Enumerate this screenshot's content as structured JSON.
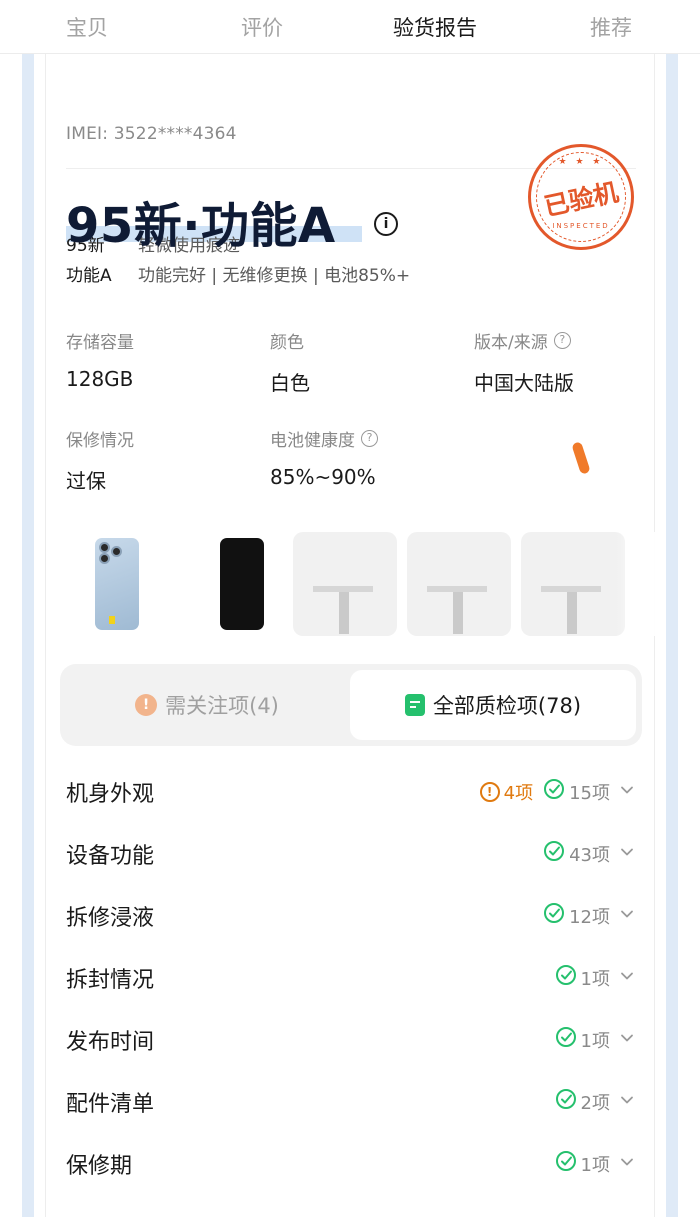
{
  "nav": {
    "tabs": [
      "宝贝",
      "评价",
      "验货报告",
      "推荐"
    ],
    "active_index": 2
  },
  "device": {
    "imei": "IMEI: 3522****4364",
    "grade_title": "95新·功能A",
    "stamp_text": "已验机",
    "stamp_sub": "INSPECTED",
    "grades": [
      {
        "key": "95新",
        "desc": "轻微使用痕迹"
      },
      {
        "key": "功能A",
        "desc": "功能完好 | 无维修更换 | 电池85%+"
      }
    ],
    "specs": [
      {
        "label": "存储容量",
        "value": "128GB"
      },
      {
        "label": "颜色",
        "value": "白色"
      },
      {
        "label": "版本/来源",
        "value": "中国大陆版"
      },
      {
        "label": "保修情况",
        "value": "过保"
      },
      {
        "label": "电池健康度",
        "value": "85%~90%"
      }
    ]
  },
  "segmented": {
    "attention": "需关注项(4)",
    "all": "全部质检项(78)"
  },
  "inspection_items": [
    {
      "title": "机身外观",
      "warn": "4项",
      "ok": "15项"
    },
    {
      "title": "设备功能",
      "ok": "43项"
    },
    {
      "title": "拆修浸液",
      "ok": "12项"
    },
    {
      "title": "拆封情况",
      "ok": "1项"
    },
    {
      "title": "发布时间",
      "ok": "1项"
    },
    {
      "title": "配件清单",
      "ok": "2项"
    },
    {
      "title": "保修期",
      "ok": "1项"
    }
  ],
  "colors": {
    "accent_green": "#25c06d",
    "warn_orange": "#e07a10",
    "stamp_red": "#e3582b",
    "stripe_blue": "#dfeaf7"
  }
}
